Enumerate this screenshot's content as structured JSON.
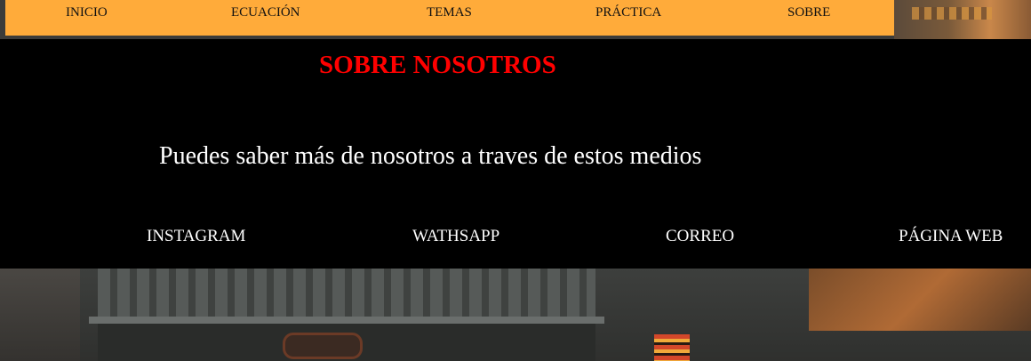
{
  "nav": {
    "items": [
      {
        "label": "INICIO"
      },
      {
        "label": "ECUACIÓN"
      },
      {
        "label": "TEMAS"
      },
      {
        "label": "PRÁCTICA"
      },
      {
        "label": "SOBRE"
      }
    ],
    "background": "#ffab3a"
  },
  "about": {
    "title": "SOBRE NOSOTROS",
    "subtitle": "Puedes saber más de nosotros a traves de estos medios",
    "links": [
      {
        "label": "INSTAGRAM"
      },
      {
        "label": "WATHSAPP"
      },
      {
        "label": "CORREO"
      },
      {
        "label": "PÁGINA WEB"
      }
    ],
    "title_color": "#ff0000",
    "panel_color": "#000000"
  }
}
